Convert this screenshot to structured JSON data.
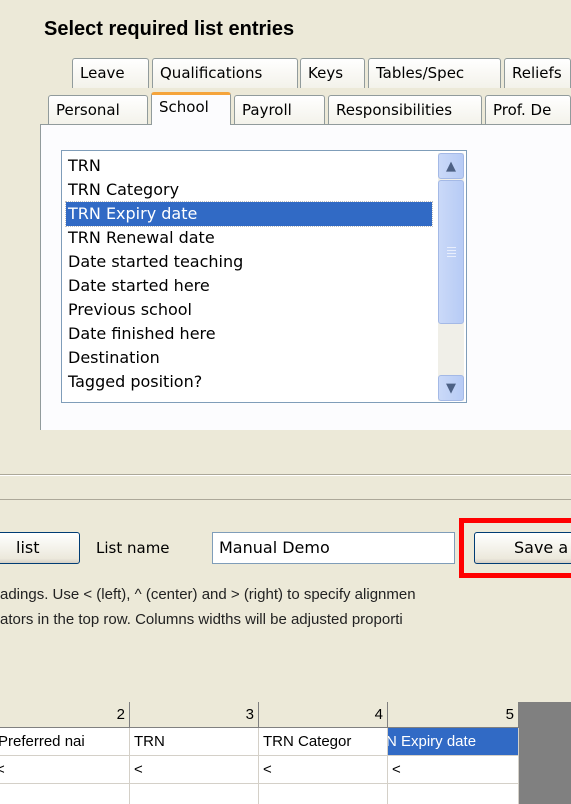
{
  "title": "Select required list entries",
  "tabs_row1": [
    "Leave",
    "Qualifications",
    "Keys",
    "Tables/Spec",
    "Reliefs"
  ],
  "tabs_row2": [
    "Personal",
    "School",
    "Payroll",
    "Responsibilities",
    "Prof. De"
  ],
  "active_tab": "School",
  "list_items": [
    "TRN",
    "TRN Category",
    "TRN Expiry date",
    "TRN Renewal date",
    "Date started teaching",
    "Date started here",
    "Previous school",
    "Date finished here",
    "Destination",
    "Tagged position?"
  ],
  "selected_item": "TRN Expiry date",
  "controls": {
    "list_button": "list",
    "list_name_label": "List name",
    "list_name_value": "Manual Demo",
    "save_button": "Save a"
  },
  "help_text": {
    "line1": "adings. Use < (left), ^ (center) and > (right) to specify alignmen",
    "line2": "ators in the top row. Columns widths will be adjusted proporti"
  },
  "grid": {
    "column_numbers": [
      "2",
      "3",
      "4",
      "5"
    ],
    "row1": [
      "Preferred nai",
      "TRN",
      "TRN Categor",
      "TRN Expiry date"
    ],
    "row2": [
      "<",
      "<",
      "<",
      "<"
    ]
  },
  "colors": {
    "selection": "#316ac5",
    "highlight_box": "#ff0000",
    "active_tab_accent": "#f5a43b"
  }
}
